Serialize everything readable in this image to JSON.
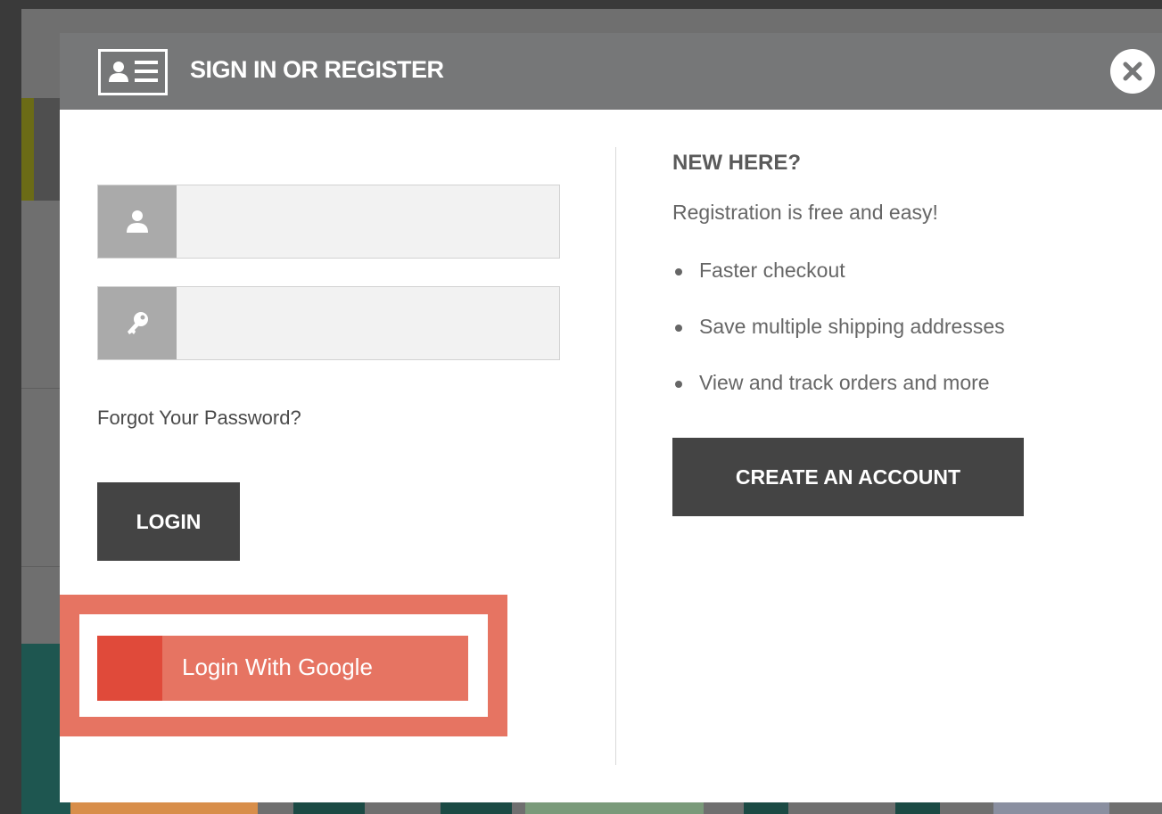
{
  "modal": {
    "title": "SIGN IN OR REGISTER",
    "header_icon": "id-card-icon",
    "close_icon": "close-icon"
  },
  "login_form": {
    "username": {
      "value": "",
      "icon": "user-icon"
    },
    "password": {
      "value": "",
      "icon": "key-icon"
    },
    "forgot_password": "Forgot Your Password?",
    "login_label": "LOGIN",
    "google_label": "Login With Google"
  },
  "register": {
    "heading": "NEW HERE?",
    "subheading": "Registration is free and easy!",
    "benefits": [
      "Faster checkout",
      "Save multiple shipping addresses",
      "View and track orders and more"
    ],
    "create_label": "CREATE AN ACCOUNT"
  },
  "colors": {
    "header_bg": "#767778",
    "button_dark": "#444444",
    "google_light": "#e67462",
    "google_dark": "#e04a3a",
    "highlight": "#e67462"
  }
}
